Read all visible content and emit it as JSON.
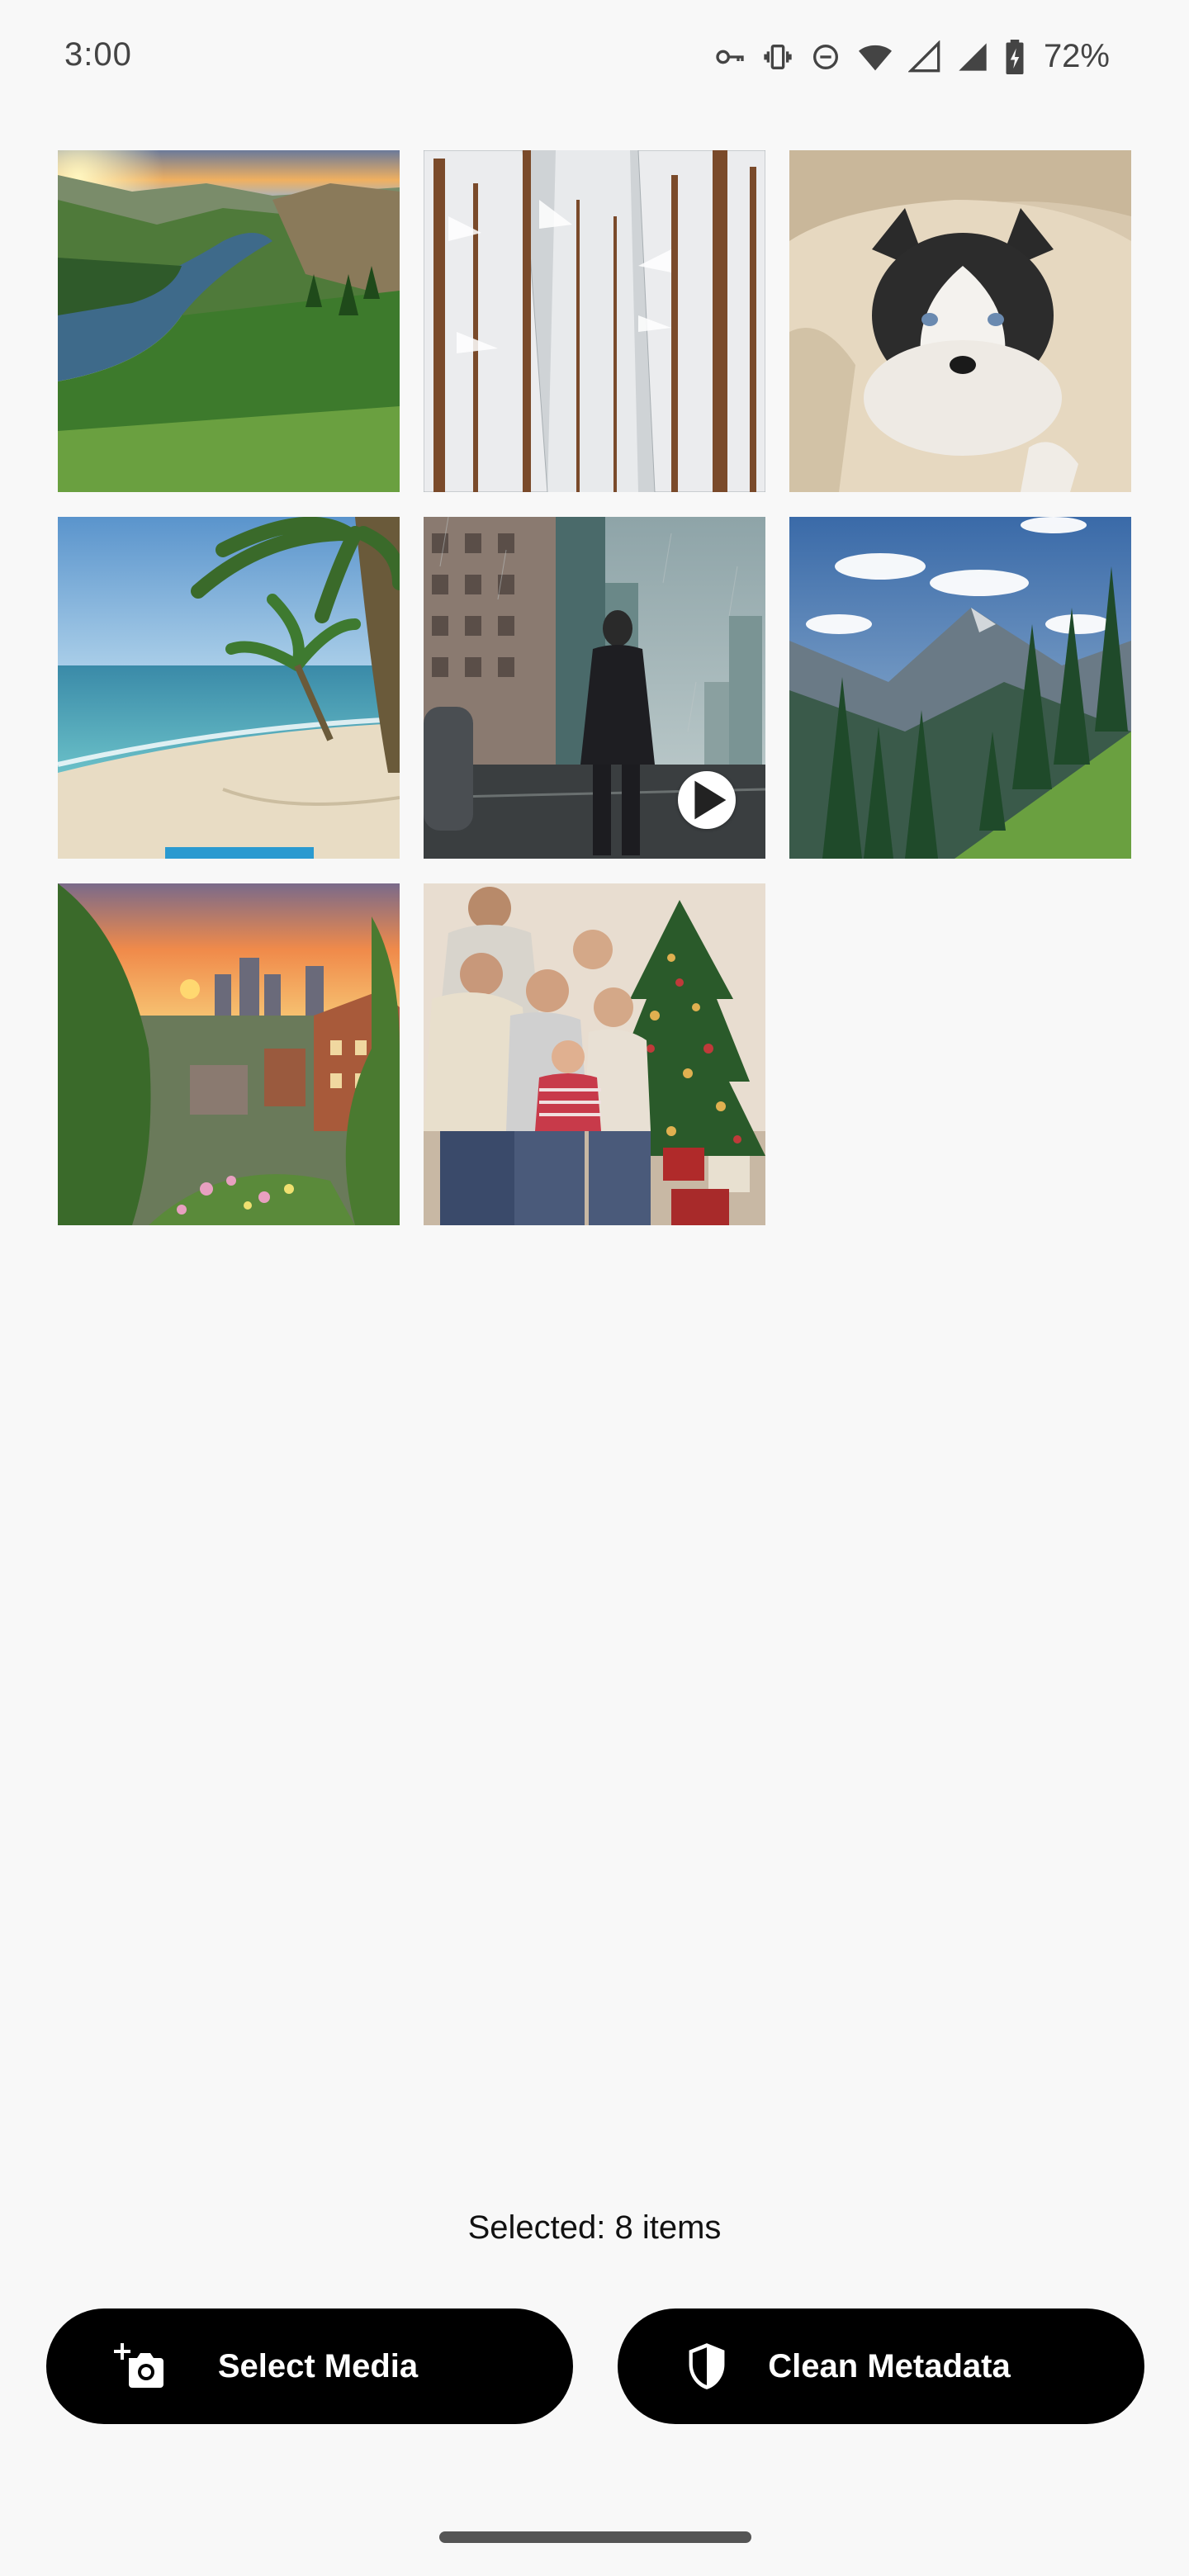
{
  "status_bar": {
    "time": "3:00",
    "battery": "72%",
    "icons": [
      "vpn-key-icon",
      "vibrate-icon",
      "do-not-disturb-icon",
      "wifi-icon",
      "signal-icon",
      "signal-icon",
      "battery-charging-icon"
    ]
  },
  "gallery": {
    "items": [
      {
        "subject": "river valley at sunset",
        "is_video": false
      },
      {
        "subject": "snowy forest",
        "is_video": false
      },
      {
        "subject": "husky under blanket",
        "is_video": false
      },
      {
        "subject": "tropical beach with palm trees",
        "is_video": false
      },
      {
        "subject": "man in rainy city street",
        "is_video": true
      },
      {
        "subject": "mountain and pine forest",
        "is_video": false
      },
      {
        "subject": "town at sunset with garden",
        "is_video": false
      },
      {
        "subject": "family by christmas tree",
        "is_video": false
      }
    ]
  },
  "selection": {
    "text": "Selected: 8 items"
  },
  "actions": {
    "select_media_label": "Select Media",
    "clean_metadata_label": "Clean Metadata"
  },
  "colors": {
    "background": "#f8f8f8",
    "button": "#000000",
    "button_text": "#ffffff"
  }
}
